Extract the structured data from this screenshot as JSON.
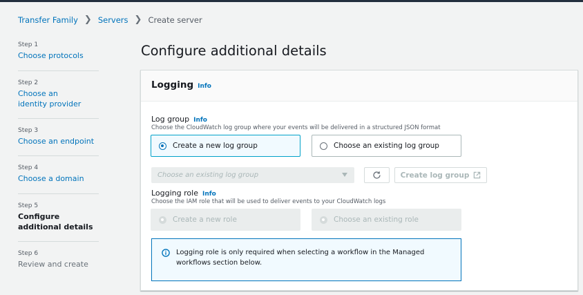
{
  "breadcrumb": {
    "items": [
      "Transfer Family",
      "Servers"
    ],
    "current": "Create server"
  },
  "steps": [
    {
      "num": "Step 1",
      "label": "Choose protocols",
      "state": "link"
    },
    {
      "num": "Step 2",
      "label": "Choose an identity provider",
      "state": "link"
    },
    {
      "num": "Step 3",
      "label": "Choose an endpoint",
      "state": "link"
    },
    {
      "num": "Step 4",
      "label": "Choose a domain",
      "state": "link"
    },
    {
      "num": "Step 5",
      "label": "Configure additional details",
      "state": "current"
    },
    {
      "num": "Step 6",
      "label": "Review and create",
      "state": "disabled"
    }
  ],
  "page_title": "Configure additional details",
  "logging": {
    "title": "Logging",
    "info": "Info",
    "log_group": {
      "label": "Log group",
      "info": "Info",
      "description": "Choose the CloudWatch log group where your events will be delivered in a structured JSON format",
      "option_new": "Create a new log group",
      "option_existing": "Choose an existing log group",
      "select_placeholder": "Choose an existing log group",
      "create_button": "Create log group"
    },
    "logging_role": {
      "label": "Logging role",
      "info": "Info",
      "description": "Choose the IAM role that will be used to deliver events to your CloudWatch logs",
      "option_new": "Create a new role",
      "option_existing": "Choose an existing role"
    },
    "alert_text": "Logging role is only required when selecting a workflow in the Managed workflows section below."
  },
  "colors": {
    "link": "#0073bb",
    "selected_border": "#00a1c9",
    "selected_bg": "#f1faff",
    "disabled": "#aab7b8"
  }
}
